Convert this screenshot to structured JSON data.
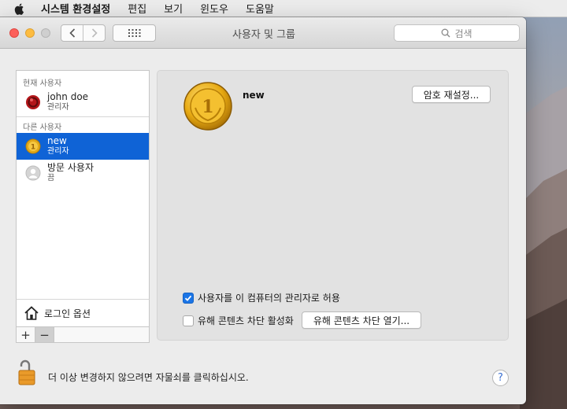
{
  "menubar": {
    "apple_icon": "apple-logo-icon",
    "items": [
      "시스템 환경설정",
      "편집",
      "보기",
      "윈도우",
      "도움말"
    ]
  },
  "window": {
    "title": "사용자 및 그룹",
    "search_placeholder": "검색"
  },
  "sidebar": {
    "current_header": "현재 사용자",
    "other_header": "다른 사용자",
    "current_user": {
      "name": "john doe",
      "role": "관리자",
      "avatar": "red-ball-avatar"
    },
    "other_users": [
      {
        "name": "new",
        "role": "관리자",
        "avatar": "gold-coin-avatar",
        "selected": true
      },
      {
        "name": "방문 사용자",
        "role": "끔",
        "avatar": "generic-person-avatar",
        "selected": false
      }
    ],
    "login_options": "로그인 옵션",
    "add_label": "+",
    "remove_label": "−"
  },
  "detail": {
    "username": "new",
    "reset_password": "암호 재설정...",
    "admin_checkbox": {
      "label": "사용자를 이 컴퓨터의 관리자로 허용",
      "checked": true
    },
    "parental_checkbox": {
      "label": "유해 콘텐츠 차단 활성화",
      "checked": false
    },
    "parental_open_button": "유해 콘텐츠 차단 열기..."
  },
  "footer": {
    "lock_text": "더 이상 변경하지 않으려면 자물쇠를 클릭하십시오.",
    "help": "?"
  },
  "colors": {
    "selection": "#0f63d6",
    "checkbox_on": "#1b75e6",
    "close": "#fc605b",
    "minimize": "#fdbc40"
  }
}
